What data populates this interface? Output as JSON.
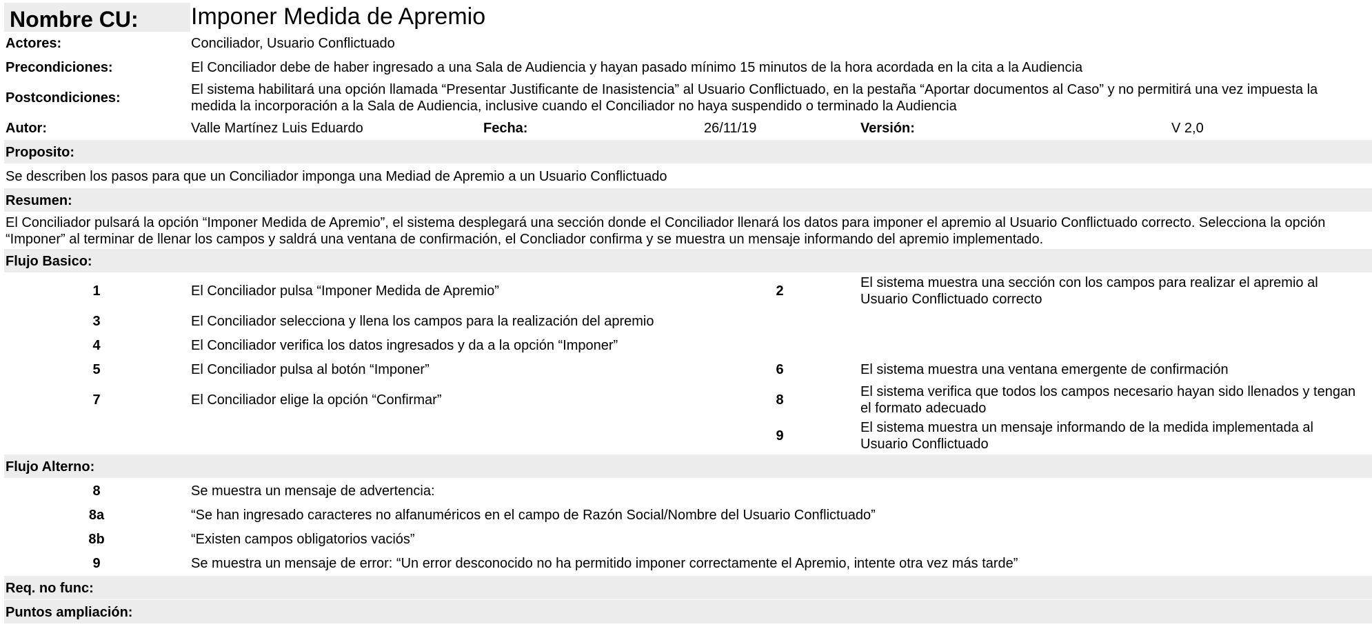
{
  "header": {
    "nombre_label": "Nombre CU:",
    "nombre_value": "Imponer Medida de Apremio",
    "actores_label": "Actores:",
    "actores_value": "Conciliador, Usuario Conflictuado",
    "pre_label": "Precondiciones:",
    "pre_value": "El Conciliador debe de haber ingresado a una Sala de Audiencia y hayan pasado mínimo 15 minutos de la hora acordada en la cita a la Audiencia",
    "post_label": "Postcondiciones:",
    "post_value": "El sistema habilitará una opción llamada “Presentar Justificante de Inasistencia” al Usuario Conflictuado, en la pestaña “Aportar documentos al Caso” y no permitirá una vez impuesta la medida la incorporación a la Sala de Audiencia, inclusive cuando el Conciliador no haya suspendido o terminado la Audiencia",
    "autor_label": "Autor:",
    "autor_value": "Valle Martínez Luis Eduardo",
    "fecha_label": "Fecha:",
    "fecha_value": "26/11/19",
    "version_label": "Versión:",
    "version_value": "V 2,0"
  },
  "proposito": {
    "label": "Proposito:",
    "text": "Se describen los pasos para que un Conciliador imponga una Mediad de Apremio a un Usuario Conflictuado"
  },
  "resumen": {
    "label": "Resumen:",
    "text": "El Conciliador pulsará la opción “Imponer Medida de Apremio”, el sistema desplegará una sección donde el Conciliador llenará los datos para imponer el apremio al Usuario Conflictuado correcto. Selecciona la opción “Imponer” al terminar de llenar los campos y saldrá una ventana de confirmación, el Concliador confirma y se muestra un mensaje informando del apremio implementado."
  },
  "flujo_basico": {
    "label": "Flujo Basico:",
    "rows": [
      {
        "n1": "1",
        "t1": "El Conciliador pulsa “Imponer Medida de Apremio”",
        "n2": "2",
        "t2": "El sistema muestra una sección con los campos para realizar el apremio al Usuario Conflictuado correcto"
      },
      {
        "n1": "3",
        "t1": "El Conciliador selecciona y llena los campos para la realización del apremio",
        "n2": "",
        "t2": ""
      },
      {
        "n1": "4",
        "t1": "El Conciliador verifica los datos ingresados y da a la opción “Imponer”",
        "n2": "",
        "t2": ""
      },
      {
        "n1": "5",
        "t1": "El Conciliador pulsa al botón “Imponer”",
        "n2": "6",
        "t2": "El sistema muestra una ventana emergente de confirmación"
      },
      {
        "n1": "7",
        "t1": "El Conciliador elige la opción “Confirmar”",
        "n2": "8",
        "t2": "El sistema verifica que todos los campos necesario hayan sido llenados y tengan el formato adecuado"
      },
      {
        "n1": "",
        "t1": "",
        "n2": "9",
        "t2": "El sistema muestra un mensaje informando de la medida implementada al Usuario Conflictuado"
      }
    ]
  },
  "flujo_alterno": {
    "label": "Flujo Alterno:",
    "rows": [
      {
        "n": "8",
        "t": "Se muestra un mensaje de advertencia:"
      },
      {
        "n": "8a",
        "t": "“Se han ingresado caracteres no alfanuméricos en el campo de Razón Social/Nombre del Usuario Conflictuado”"
      },
      {
        "n": "8b",
        "t": "“Existen campos obligatorios vaciós”"
      },
      {
        "n": "9",
        "t": "Se muestra un mensaje de error: “Un error desconocido no ha permitido imponer correctamente el Apremio, intente otra vez más tarde”"
      }
    ]
  },
  "req_no_func": {
    "label": "Req. no func:"
  },
  "puntos_ampliacion": {
    "label": "Puntos ampliación:"
  }
}
